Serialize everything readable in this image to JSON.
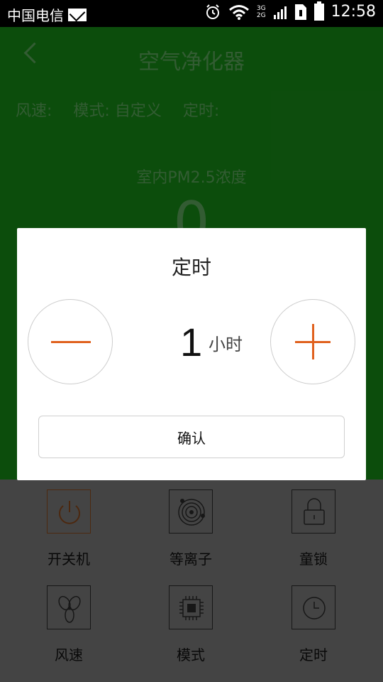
{
  "status_bar": {
    "carrier": "中国电信",
    "time": "12:58",
    "net_3g": "3G",
    "net_2g": "2G",
    "icons": [
      "mail-icon",
      "alarm-icon",
      "wifi-icon",
      "signal-icon",
      "sim-icon",
      "battery-icon"
    ]
  },
  "header": {
    "title": "空气净化器"
  },
  "info": {
    "wind": "风速:",
    "mode": "模式: 自定义",
    "timer": "定时:"
  },
  "pm": {
    "label": "室内PM2.5浓度",
    "value": "0"
  },
  "dialog": {
    "title": "定时",
    "value": "1",
    "unit": "小时",
    "confirm_label": "确认"
  },
  "controls": {
    "items": [
      {
        "label": "开关机",
        "icon": "power-icon"
      },
      {
        "label": "等离子",
        "icon": "plasma-icon"
      },
      {
        "label": "童锁",
        "icon": "lock-icon"
      },
      {
        "label": "风速",
        "icon": "fan-icon"
      },
      {
        "label": "模式",
        "icon": "chip-icon"
      },
      {
        "label": "定时",
        "icon": "clock-icon"
      }
    ]
  },
  "colors": {
    "app_green": "#178d17",
    "accent_orange": "#e0611e"
  }
}
